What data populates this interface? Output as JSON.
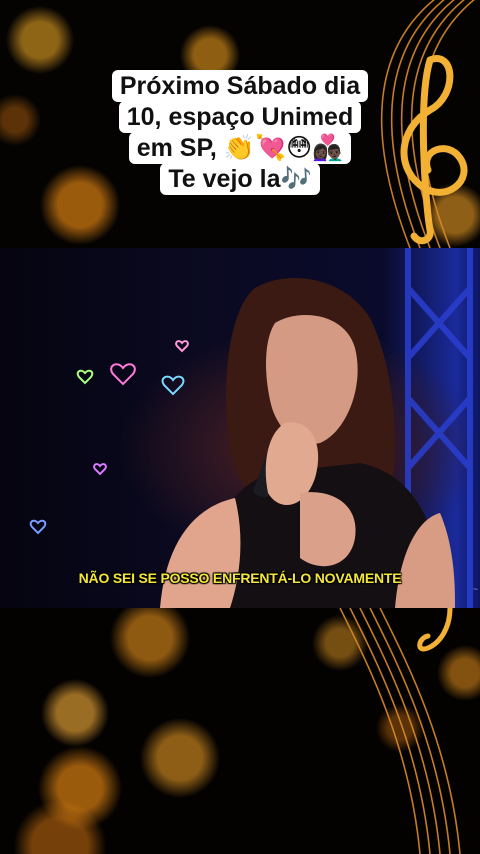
{
  "caption": {
    "lines": [
      "Próximo Sábado dia",
      "10, espaço Unimed",
      "em SP, 👏💘😳👩🏿‍❤️‍👨🏿",
      "Te vejo la🎶"
    ]
  },
  "video": {
    "subtitle": "NÃO SEI SE POSSO ENFRENTÁ-LO NOVAMENTE"
  },
  "decor": {
    "accent_gold": "#f2b035",
    "stage_blue": "#1a2a9a",
    "subtitle_color": "#f3e63a",
    "icons": [
      "treble-clef-icon",
      "music-staff-icon",
      "heart-icon",
      "microphone-icon"
    ]
  }
}
